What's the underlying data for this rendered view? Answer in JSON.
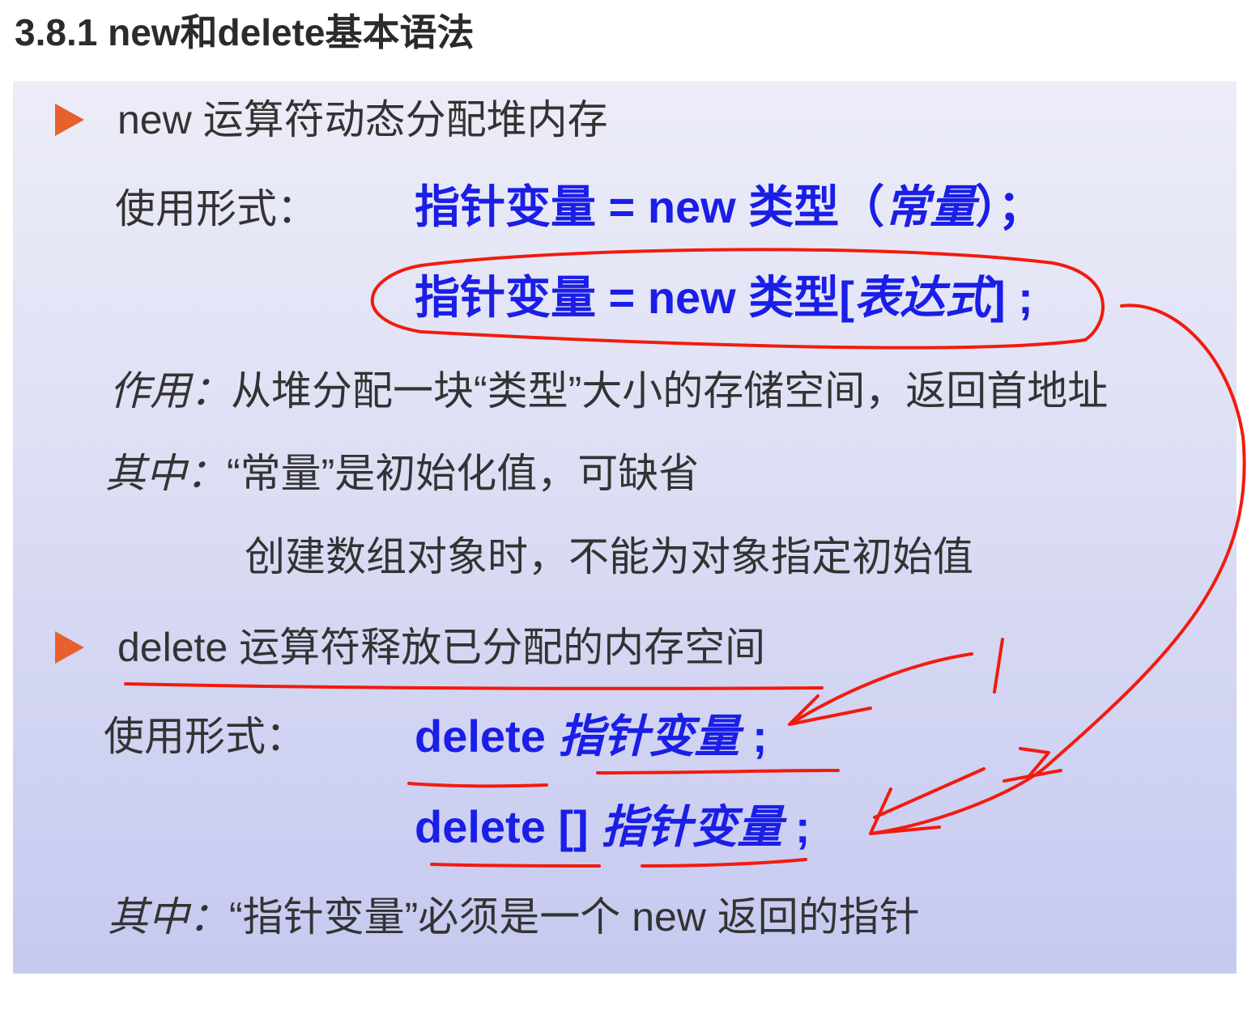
{
  "heading": "3.8.1 new和delete基本语法",
  "slide": {
    "bullet_icon": "orange-arrowhead-icon",
    "annotation_color": "#f21b0e",
    "code_color": "#1a1ee6",
    "new_section": {
      "bullet": "new 运算符动态分配堆内存",
      "usage_label": "使用形式：",
      "form1_prefix": "指针变量 = new 类型（",
      "form1_arg": "常量",
      "form1_suffix": "）；",
      "form2_prefix": "指针变量 = new 类型[",
      "form2_arg": "表达式",
      "form2_suffix": "] ;",
      "effect_label": "作用：",
      "effect_text": "从堆分配一块“类型”大小的存储空间，返回首地址",
      "note_label": "其中：",
      "note_text": "“常量”是初始化值，可缺省",
      "note_text2": "创建数组对象时，不能为对象指定初始值"
    },
    "delete_section": {
      "bullet": "delete 运算符释放已分配的内存空间",
      "usage_label": "使用形式：",
      "form1_keyword": "delete ",
      "form1_arg": "指针变量",
      "form1_suffix": " ;",
      "form2_keyword": "delete [] ",
      "form2_arg": "指针变量",
      "form2_suffix": " ;",
      "note_label": "其中：",
      "note_text": "“指针变量”必须是一个 new 返回的指针"
    }
  }
}
